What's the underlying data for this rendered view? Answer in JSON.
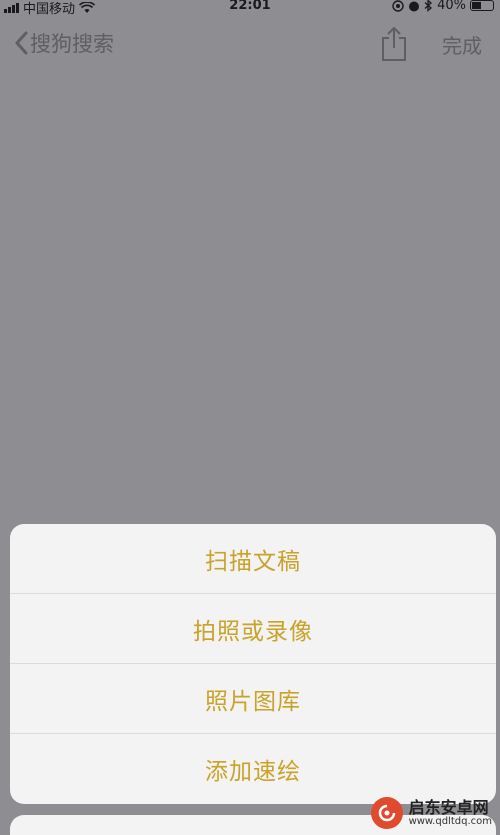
{
  "status_bar": {
    "carrier": "中国移动",
    "time": "22:01",
    "battery": "40%"
  },
  "nav": {
    "back_label": "搜狗搜索",
    "done_label": "完成"
  },
  "action_sheet": {
    "items": [
      {
        "label": "扫描文稿"
      },
      {
        "label": "拍照或录像"
      },
      {
        "label": "照片图库"
      },
      {
        "label": "添加速绘"
      }
    ]
  },
  "watermark": {
    "title": "启东安卓网",
    "url": "www.qdltdq.com"
  },
  "colors": {
    "accent": "#c9a227",
    "dimmed_background": "#8e8d92",
    "sheet_background": "#f4f3f3"
  },
  "icons": [
    "wifi-icon",
    "location-icon",
    "alarm-icon",
    "bluetooth-icon",
    "battery-icon",
    "chevron-left-icon",
    "share-icon"
  ]
}
